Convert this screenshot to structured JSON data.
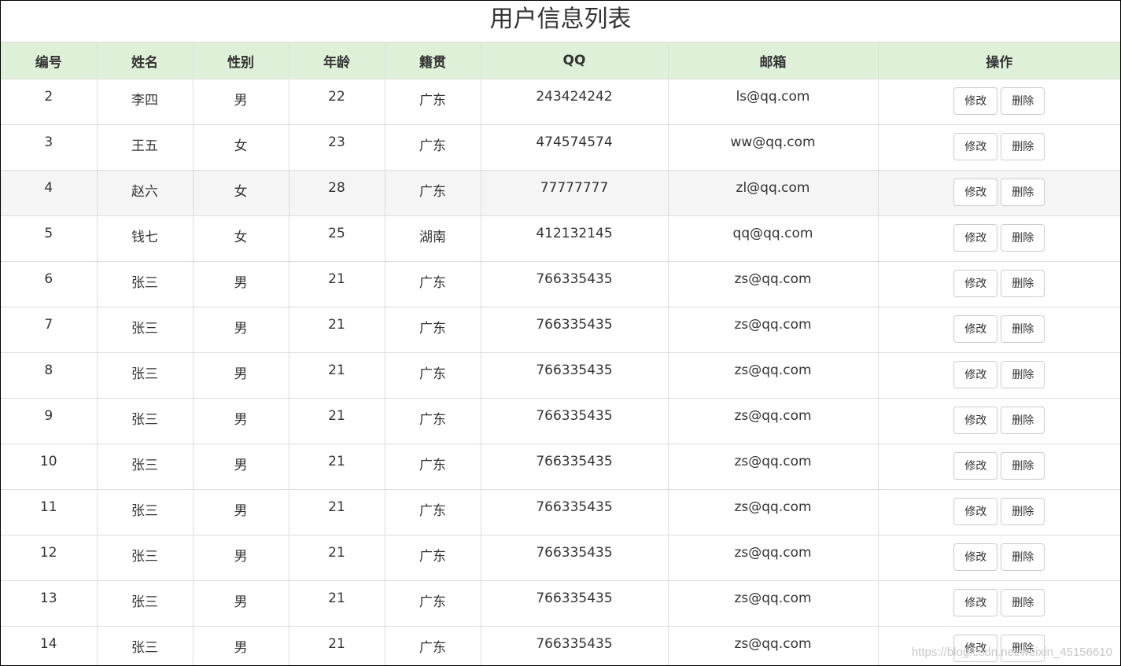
{
  "page": {
    "title": "用户信息列表"
  },
  "table": {
    "headers": [
      "编号",
      "姓名",
      "性别",
      "年龄",
      "籍贯",
      "QQ",
      "邮箱",
      "操作"
    ],
    "rows": [
      {
        "id": "2",
        "name": "李四",
        "gender": "男",
        "age": "22",
        "hometown": "广东",
        "qq": "243424242",
        "email": "ls@qq.com"
      },
      {
        "id": "3",
        "name": "王五",
        "gender": "女",
        "age": "23",
        "hometown": "广东",
        "qq": "474574574",
        "email": "ww@qq.com"
      },
      {
        "id": "4",
        "name": "赵六",
        "gender": "女",
        "age": "28",
        "hometown": "广东",
        "qq": "77777777",
        "email": "zl@qq.com"
      },
      {
        "id": "5",
        "name": "钱七",
        "gender": "女",
        "age": "25",
        "hometown": "湖南",
        "qq": "412132145",
        "email": "qq@qq.com"
      },
      {
        "id": "6",
        "name": "张三",
        "gender": "男",
        "age": "21",
        "hometown": "广东",
        "qq": "766335435",
        "email": "zs@qq.com"
      },
      {
        "id": "7",
        "name": "张三",
        "gender": "男",
        "age": "21",
        "hometown": "广东",
        "qq": "766335435",
        "email": "zs@qq.com"
      },
      {
        "id": "8",
        "name": "张三",
        "gender": "男",
        "age": "21",
        "hometown": "广东",
        "qq": "766335435",
        "email": "zs@qq.com"
      },
      {
        "id": "9",
        "name": "张三",
        "gender": "男",
        "age": "21",
        "hometown": "广东",
        "qq": "766335435",
        "email": "zs@qq.com"
      },
      {
        "id": "10",
        "name": "张三",
        "gender": "男",
        "age": "21",
        "hometown": "广东",
        "qq": "766335435",
        "email": "zs@qq.com"
      },
      {
        "id": "11",
        "name": "张三",
        "gender": "男",
        "age": "21",
        "hometown": "广东",
        "qq": "766335435",
        "email": "zs@qq.com"
      },
      {
        "id": "12",
        "name": "张三",
        "gender": "男",
        "age": "21",
        "hometown": "广东",
        "qq": "766335435",
        "email": "zs@qq.com"
      },
      {
        "id": "13",
        "name": "张三",
        "gender": "男",
        "age": "21",
        "hometown": "广东",
        "qq": "766335435",
        "email": "zs@qq.com"
      },
      {
        "id": "14",
        "name": "张三",
        "gender": "男",
        "age": "21",
        "hometown": "广东",
        "qq": "766335435",
        "email": "zs@qq.com"
      }
    ],
    "hover_row_index": 2,
    "actions": {
      "edit_label": "修改",
      "delete_label": "删除"
    }
  },
  "watermark": "https://blog.csdn.net/weixin_45156610",
  "colors": {
    "header_bg": "#dff0d8",
    "hover_row_bg": "#f5f5f5",
    "border": "#dddddd"
  }
}
